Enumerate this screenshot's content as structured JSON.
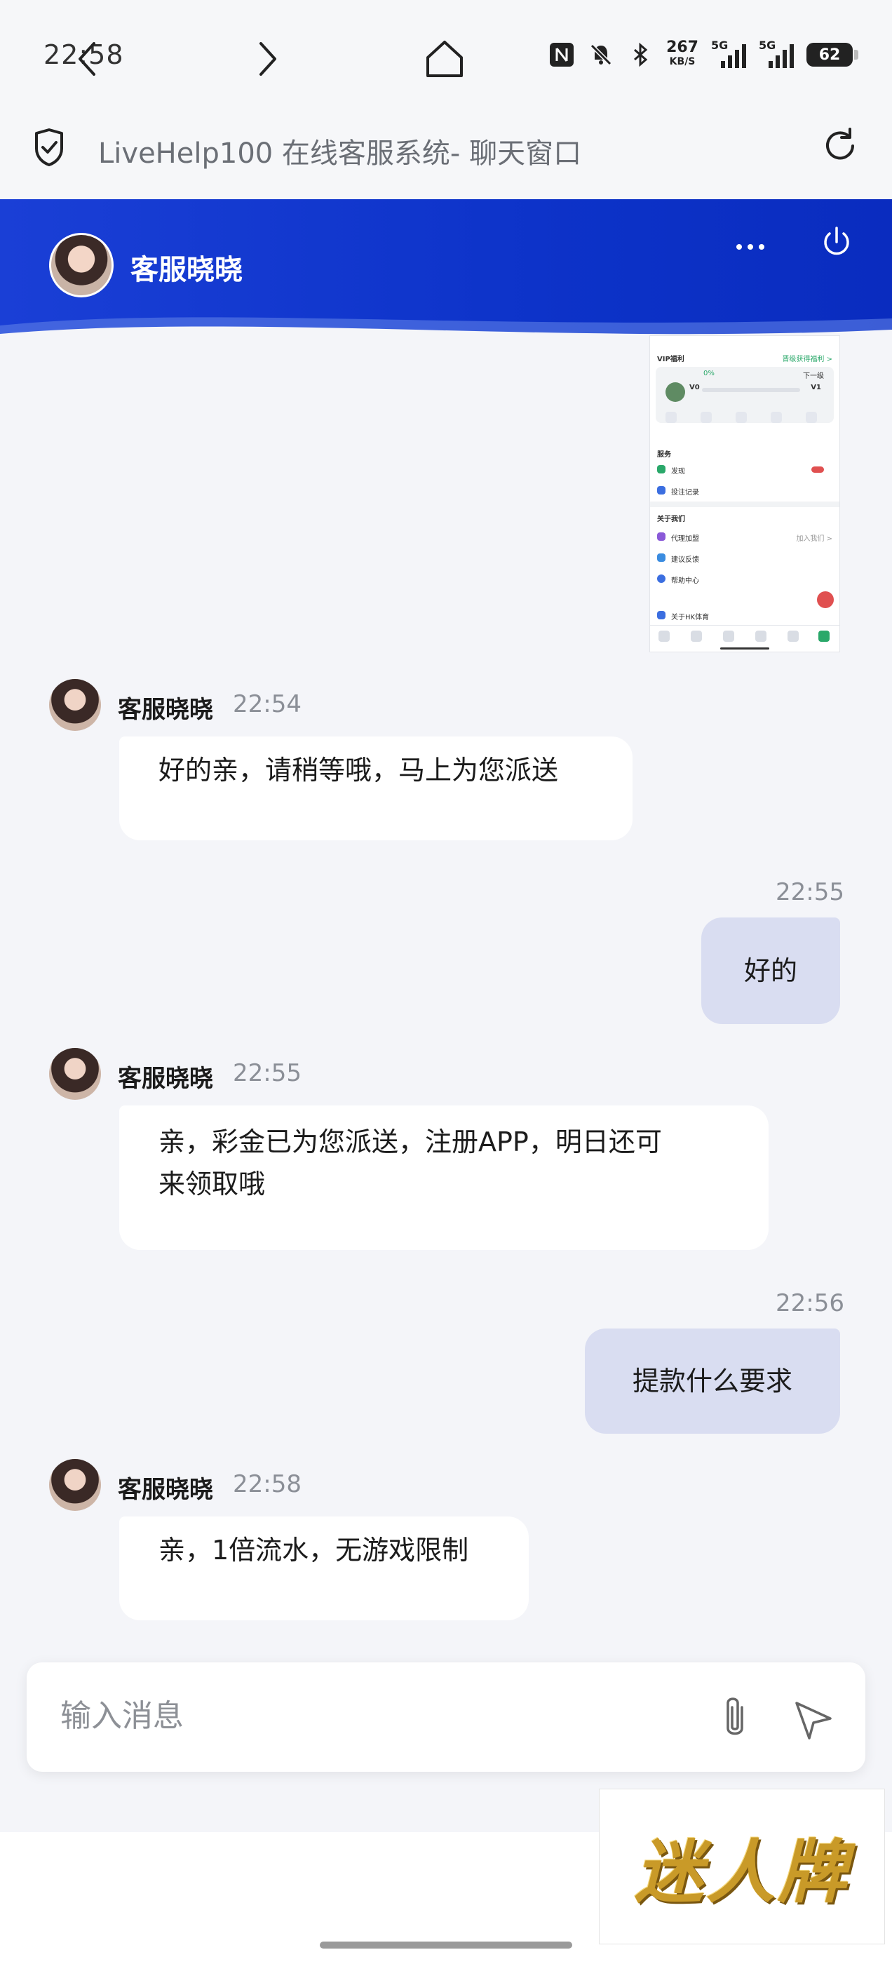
{
  "status_bar": {
    "time": "22:58",
    "net_speed": "267",
    "net_unit": "KB/S",
    "signal1_label": "5G",
    "signal2_label": "5G",
    "battery": "62"
  },
  "browser": {
    "page_title": "LiveHelp100 在线客服系统- 聊天窗口"
  },
  "chat_header": {
    "agent_name": "客服晓晓"
  },
  "shared_image": {
    "vip_label": "VIP福利",
    "vip_link": "晋级获得福利 >",
    "progress_pct": "0%",
    "level_from": "V0",
    "level_to": "V1",
    "next_level": "下一级",
    "section_service": "服务",
    "item_discover": "发现",
    "item_records": "投注记录",
    "section_about": "关于我们",
    "item_agent": "代理加盟",
    "item_agent_right": "加入我们 >",
    "item_feedback": "建议反馈",
    "item_help": "帮助中心",
    "item_about_hk": "关于HK体育"
  },
  "messages": [
    {
      "sender": "客服晓晓",
      "time": "22:54",
      "text": "好的亲，请稍等哦，马上为您派送"
    },
    {
      "time": "22:55",
      "text": "好的"
    },
    {
      "sender": "客服晓晓",
      "time": "22:55",
      "text_line1": "亲，彩金已为您派送，注册APP，明日还可",
      "text_line2": "来领取哦"
    },
    {
      "time": "22:56",
      "text": "提款什么要求"
    },
    {
      "sender": "客服晓晓",
      "time": "22:58",
      "text": "亲，1倍流水，无游戏限制"
    }
  ],
  "composer": {
    "placeholder": "输入消息"
  },
  "watermark": {
    "text": "迷人牌"
  },
  "colors": {
    "header_blue": "#1a3fd6",
    "outgoing_bubble": "#d9ddf1",
    "chat_bg": "#f4f5f9"
  }
}
